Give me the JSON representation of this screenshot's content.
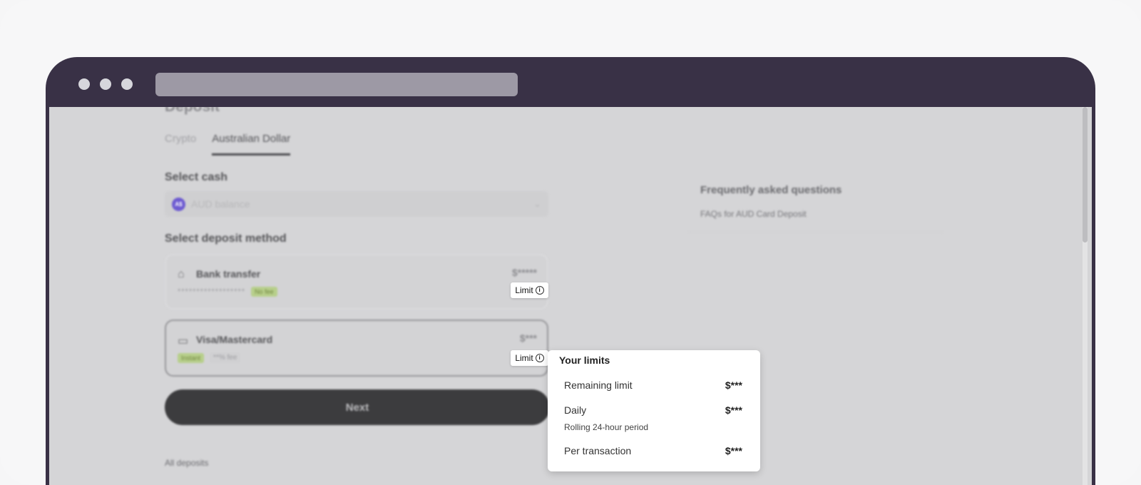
{
  "page": {
    "title": "Deposit",
    "tabs": [
      {
        "label": "Crypto"
      },
      {
        "label": "Australian Dollar"
      }
    ],
    "select_cash": {
      "label": "Select cash",
      "currency_badge": "A$",
      "value": "AUD balance"
    },
    "deposit_method": {
      "label": "Select deposit method",
      "methods": [
        {
          "name": "Bank transfer",
          "masked": "******************",
          "tag": "No fee",
          "amount": "$*****",
          "limit_label": "Limit"
        },
        {
          "name": "Visa/Mastercard",
          "tag": "Instant",
          "fee": "**% fee",
          "amount": "$***",
          "limit_label": "Limit"
        }
      ]
    },
    "next_label": "Next",
    "all_deposits_label": "All deposits",
    "faq": {
      "title": "Frequently asked questions",
      "link": "FAQs for AUD Card Deposit"
    }
  },
  "popover": {
    "title": "Your limits",
    "rows": [
      {
        "label": "Remaining limit",
        "value": "$***"
      },
      {
        "label": "Daily",
        "sub": "Rolling 24-hour period",
        "value": "$***"
      },
      {
        "label": "Per transaction",
        "value": "$***"
      }
    ]
  },
  "icons": {
    "bank": "bank-icon",
    "card": "card-icon",
    "info": "info-icon",
    "chevron": "chevron-down-icon"
  },
  "colors": {
    "browser_frame": "#393146",
    "overlay": "#d5d5d7",
    "next_button": "#3c3c3e",
    "tag_green": "#b7cf8b"
  }
}
